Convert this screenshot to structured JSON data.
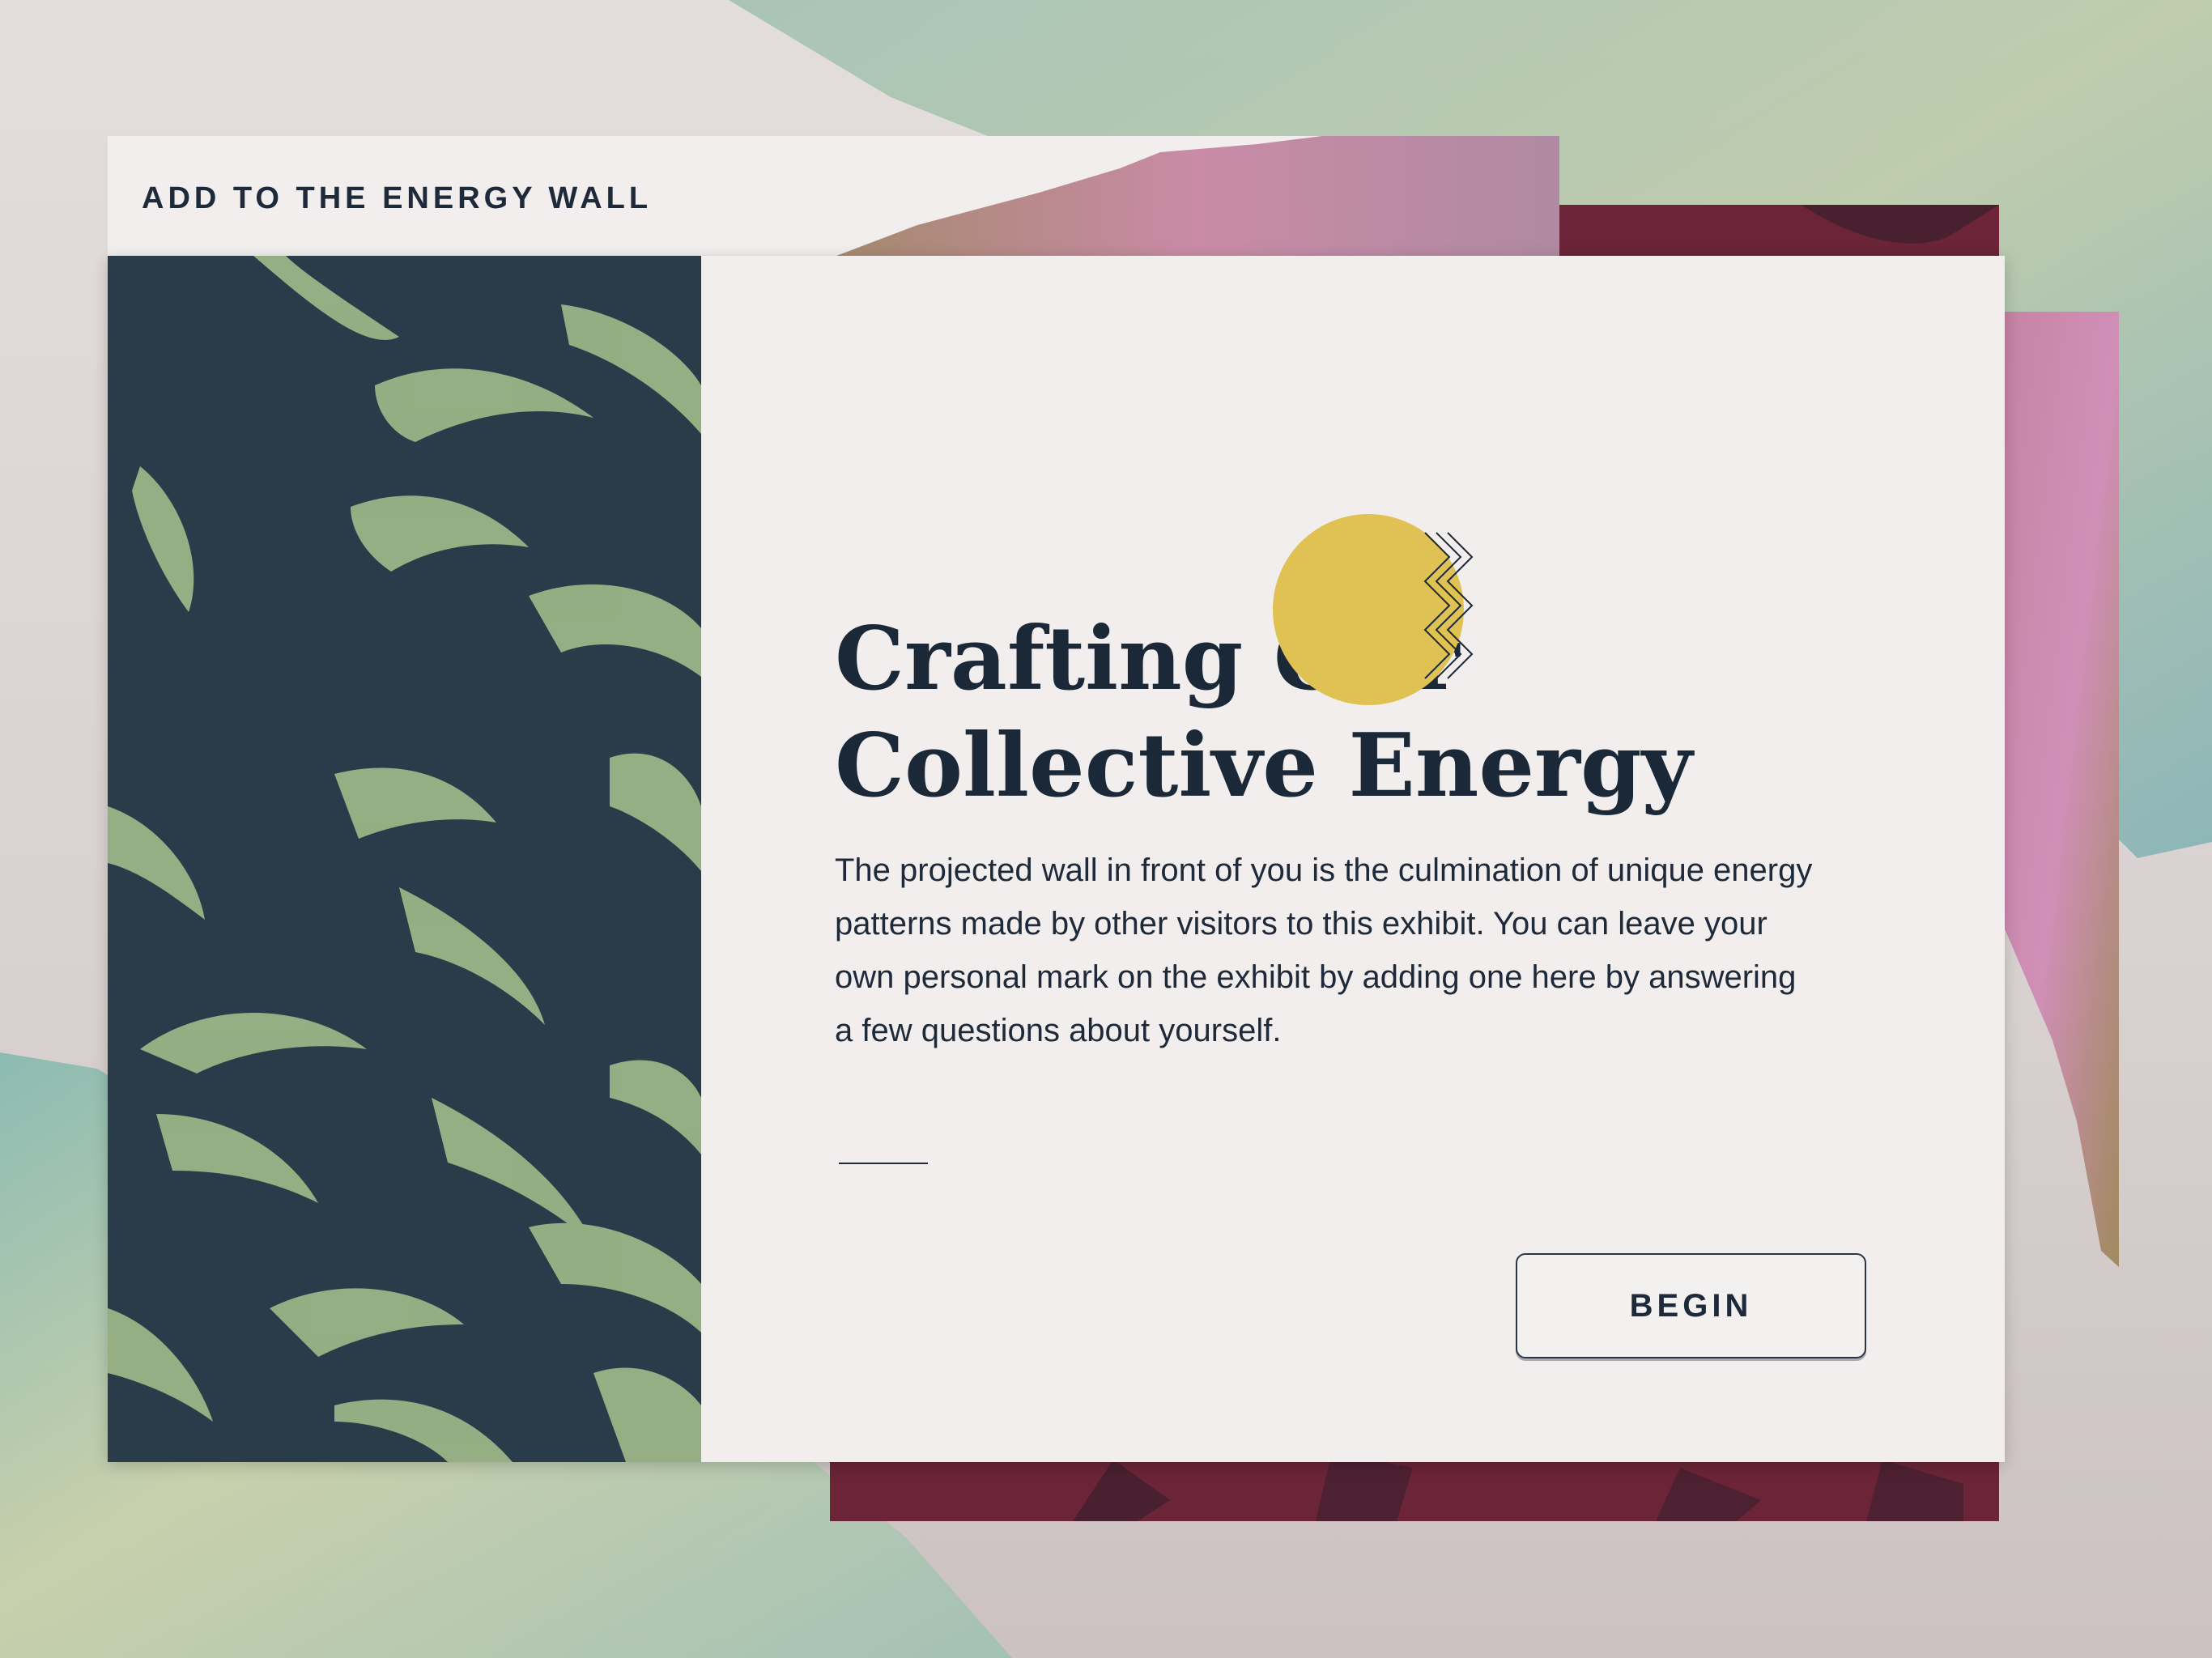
{
  "header": {
    "section_label": "ADD TO THE ENERGY WALL"
  },
  "intro": {
    "title_line1": "Crafting Our",
    "title_line2": "Collective Energy",
    "body": "The projected wall in front of you is the culmination of unique energy patterns made by other visitors to this exhibit. You can leave your own personal mark on the exhibit by adding one here by answering a few questions about yourself."
  },
  "actions": {
    "begin_label": "BEGIN"
  },
  "colors": {
    "ink": "#1b2838",
    "accent_yellow": "#dfc253",
    "panel_dark": "#2a3c4a",
    "panel_green": "#9bb486",
    "maroon": "#6b2438",
    "paper": "#f1eeed"
  },
  "icons": {
    "decor_circle": "yellow-circle-icon",
    "decor_zigzag": "zigzag-lines-icon"
  }
}
